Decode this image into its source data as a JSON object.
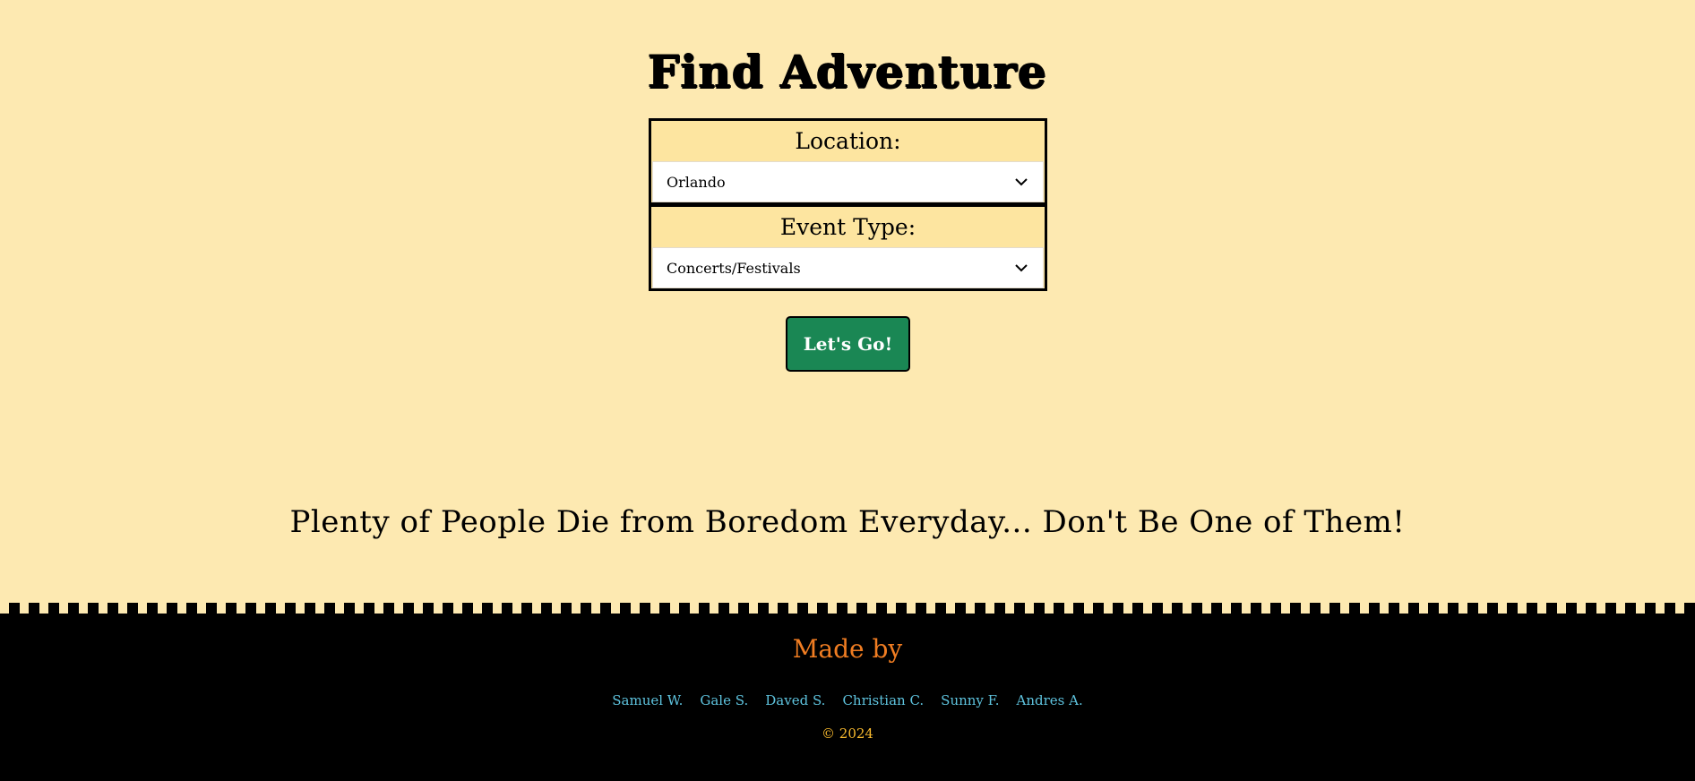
{
  "header": {
    "title": "Find Adventure"
  },
  "form": {
    "location_label": "Location:",
    "location_value": "Orlando",
    "event_type_label": "Event Type:",
    "event_type_value": "Concerts/Festivals",
    "submit_label": "Let's Go!"
  },
  "tagline": "Plenty of People Die from Boredom Everyday... Don't Be One of Them!",
  "footer": {
    "made_by": "Made by",
    "names": [
      "Samuel W.",
      "Gale S.",
      "Daved S.",
      "Christian C.",
      "Sunny F.",
      "Andres A."
    ],
    "copyright": "© 2024"
  },
  "colors": {
    "background": "#fde9b1",
    "button": "#1a8754",
    "made_by": "#f07d22",
    "names": "#5ec3de",
    "copyright": "#f7b92e"
  }
}
